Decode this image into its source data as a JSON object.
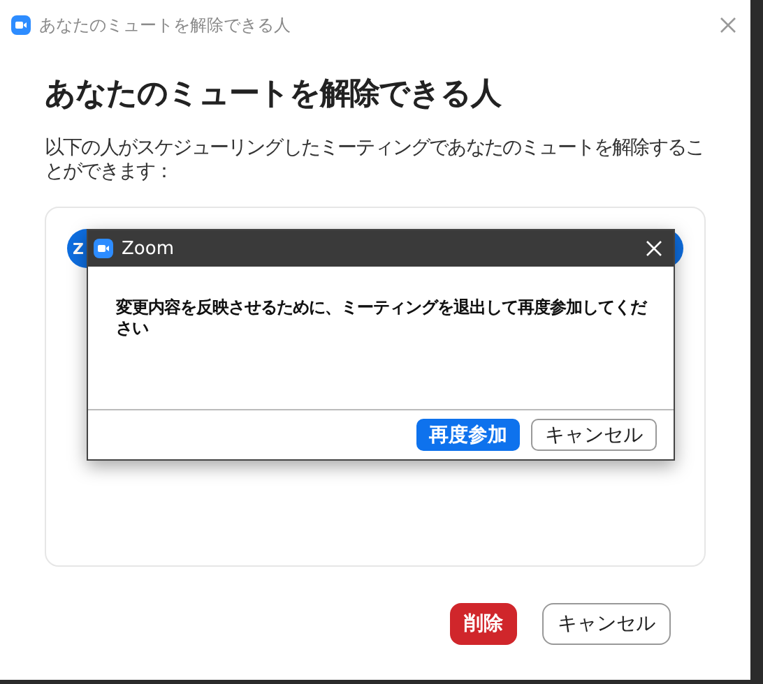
{
  "window": {
    "title": "あなたのミュートを解除できる人"
  },
  "heading": "あなたのミュートを解除できる人",
  "description": "以下の人がスケジューリングしたミーティングであなたのミュートを解除することができます：",
  "list": {
    "items": [
      {
        "label": "Z"
      }
    ]
  },
  "buttons": [
    {
      "label": "削除",
      "kind": "danger"
    },
    {
      "label": "キャンセル",
      "kind": "secondary"
    }
  ],
  "dialog": {
    "title": "Zoom",
    "message": "変更内容を反映させるために、ミーティングを退出して再度参加してください",
    "buttons": [
      {
        "label": "再度参加",
        "kind": "primary"
      },
      {
        "label": "キャンセル",
        "kind": "secondary"
      }
    ]
  }
}
